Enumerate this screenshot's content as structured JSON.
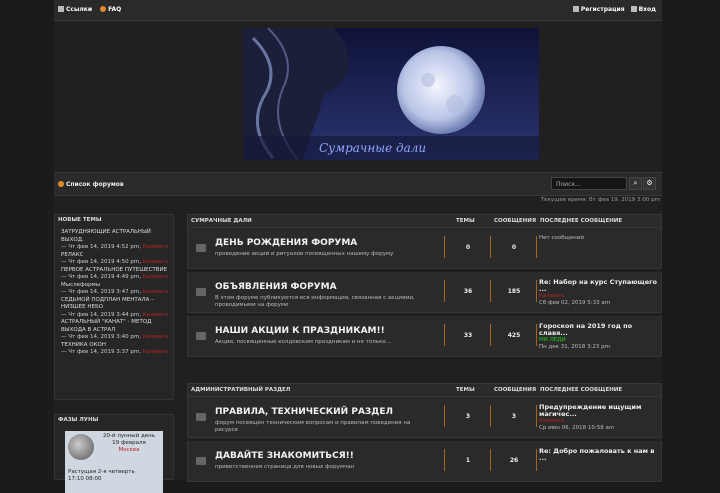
{
  "nav": {
    "links": "Ссылки",
    "faq": "FAQ",
    "register": "Регистрация",
    "login": "Вход"
  },
  "banner": {
    "caption": "Сумрачные дали"
  },
  "crumb": {
    "home": "Список форумов",
    "search_placeholder": "Поиск…"
  },
  "time": "Текущее время: Вт фев 19, 2019 3:00 pm",
  "sidebar": {
    "new_topics_title": "НОВЫЕ ТЕМЫ",
    "topics": [
      {
        "title": "ЗАТРУДНЯЮЩИЕ АСТРАЛЬНЫЙ ВЫХОД.",
        "meta": "— Чт фев 14, 2019 4:52 pm,",
        "author": "Калиюга"
      },
      {
        "title": "РЕЛАКС",
        "meta": "— Чт фев 14, 2019 4:50 pm,",
        "author": "Калиюга"
      },
      {
        "title": "ПЕРВОЕ АСТРАЛЬНОЕ ПУТЕШЕСТВИЕ",
        "meta": "— Чт фев 14, 2019 4:49 pm,",
        "author": "Калиюга"
      },
      {
        "title": "Мыслеформы",
        "meta": "— Чт фев 14, 2019 3:47 pm,",
        "author": "Калиюга"
      },
      {
        "title": "СЕДЬМОЙ ПОДПЛАН МЕНТАЛА – НИЗШЕЕ НЕБО",
        "meta": "— Чт фев 14, 2019 3:44 pm,",
        "author": "Калиюга"
      },
      {
        "title": "АСТРАЛЬНЫЙ \"КАНАТ\" - МЕТОД ВЫХОДА В АСТРАЛ",
        "meta": "— Чт фев 14, 2019 3:40 pm,",
        "author": "Калиюга"
      },
      {
        "title": "ТЕХНИКА ОКОН",
        "meta": "— Чт фев 14, 2019 3:37 pm,",
        "author": "Калиюга"
      }
    ],
    "moon_title": "ФАЗЫ ЛУНЫ",
    "moon": {
      "day": "20-й лунный день",
      "date": "19 февраля",
      "city": "Москва",
      "phase": "Растущая 2-я четверть",
      "rise": "17:10",
      "set": "08:00"
    }
  },
  "sections": [
    {
      "title": "СУМРАЧНЫЕ ДАЛИ",
      "col_topics": "ТЕМЫ",
      "col_posts": "СООБЩЕНИЯ",
      "col_last": "ПОСЛЕДНЕЕ СООБЩЕНИЕ",
      "forums": [
        {
          "name": "ДЕНЬ РОЖДЕНИЯ ФОРУМА",
          "desc": "проведение акций и ритуалов посвященных нашему форуму",
          "topics": "0",
          "posts": "0",
          "last_title": "",
          "last_author": "",
          "last_date": "Нет сообщений"
        },
        {
          "name": "ОБЪЯВЛЕНИЯ ФОРУМА",
          "desc": "В этом форуме публикуются вся информация, связанная с акциями, проводимыми на форуме",
          "topics": "36",
          "posts": "185",
          "last_title": "Re: Набор на курс Ступающего ...",
          "last_author": "Калиюга",
          "last_date": "Сб фев 02, 2019 5:33 am"
        },
        {
          "name": "НАШИ АКЦИИ К ПРАЗДНИКАМ!!",
          "desc": "Акции, посвященные колдовским праздникам и не только...",
          "topics": "33",
          "posts": "425",
          "last_title": "Гороскоп на 2019 год по славя...",
          "last_author": "МИ ЛЕДИ",
          "last_date": "Пн дек 31, 2018 3:23 pm"
        }
      ]
    },
    {
      "title": "АДМИНИСТРАТИВНЫЙ РАЗДЕЛ",
      "col_topics": "ТЕМЫ",
      "col_posts": "СООБЩЕНИЯ",
      "col_last": "ПОСЛЕДНЕЕ СООБЩЕНИЕ",
      "forums": [
        {
          "name": "ПРАВИЛА, ТЕХНИЧЕСКИЙ РАЗДЕЛ",
          "desc": "форум посвящен техническим вопросам и правилам поведения на ресурсе",
          "topics": "3",
          "posts": "3",
          "last_title": "Предупреждение ищущим магичес...",
          "last_author": "Калиюга",
          "last_date": "Ср июн 06, 2018 10:58 am"
        },
        {
          "name": "ДАВАЙТЕ ЗНАКОМИТЬСЯ!!",
          "desc": "приветственная страница для новых форумчан",
          "topics": "1",
          "posts": "26",
          "last_title": "Re: Добро пожаловать к нам в ...",
          "last_author": "",
          "last_date": ""
        }
      ]
    }
  ]
}
